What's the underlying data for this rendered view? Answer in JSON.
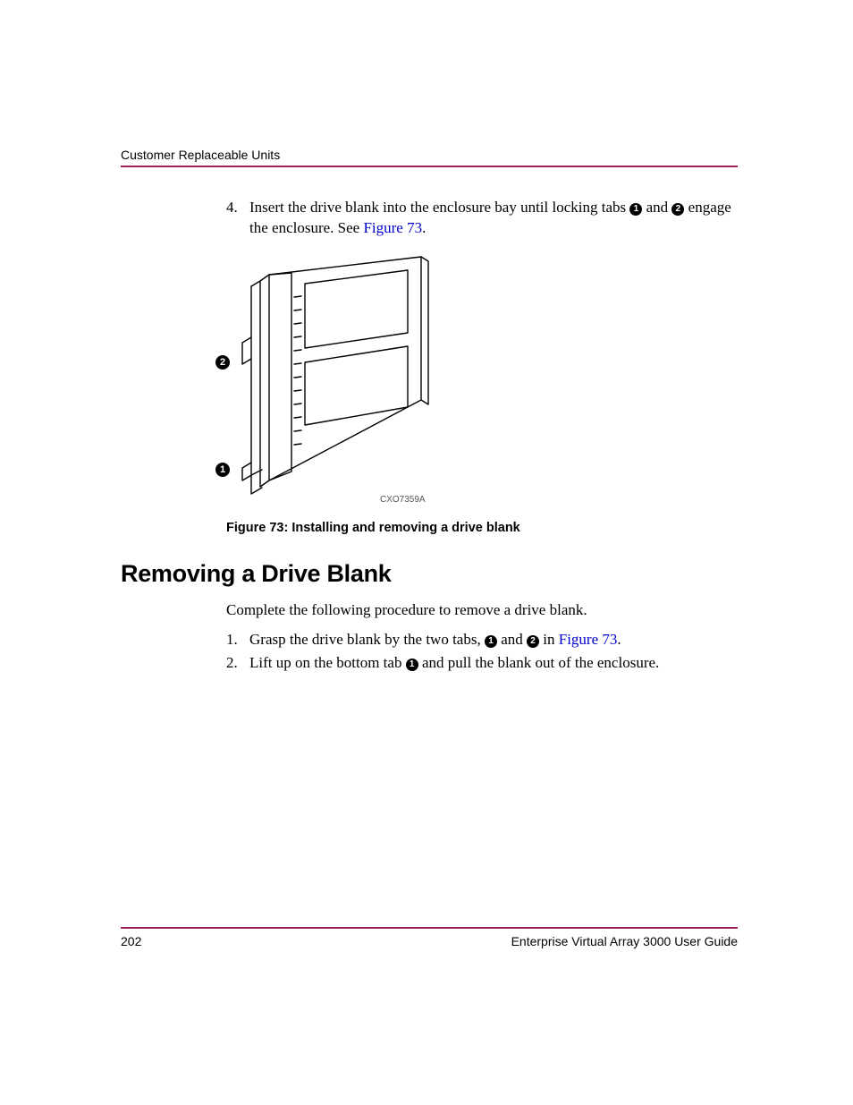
{
  "header": {
    "section": "Customer Replaceable Units"
  },
  "step4": {
    "num": "4.",
    "text_before": "Insert the drive blank into the enclosure bay until locking tabs ",
    "c1": "1",
    "mid": " and ",
    "c2": "2",
    "text_after": " engage the enclosure. See ",
    "link": "Figure 73",
    "period": "."
  },
  "figure": {
    "callout_top": "2",
    "callout_bottom": "1",
    "code": "CXO7359A",
    "caption": "Figure 73:  Installing and removing a drive blank"
  },
  "heading": "Removing a Drive Blank",
  "intro": "Complete the following procedure to remove a drive blank.",
  "steps": [
    {
      "num": "1.",
      "a": "Grasp the drive blank by the two tabs, ",
      "c1": "1",
      "mid": " and ",
      "c2": "2",
      "b": " in ",
      "link": "Figure 73",
      "tail": "."
    },
    {
      "num": "2.",
      "a": "Lift up on the bottom tab ",
      "c1": "1",
      "b": " and pull the blank out of the enclosure."
    }
  ],
  "footer": {
    "page": "202",
    "doc": "Enterprise Virtual Array 3000 User Guide"
  }
}
